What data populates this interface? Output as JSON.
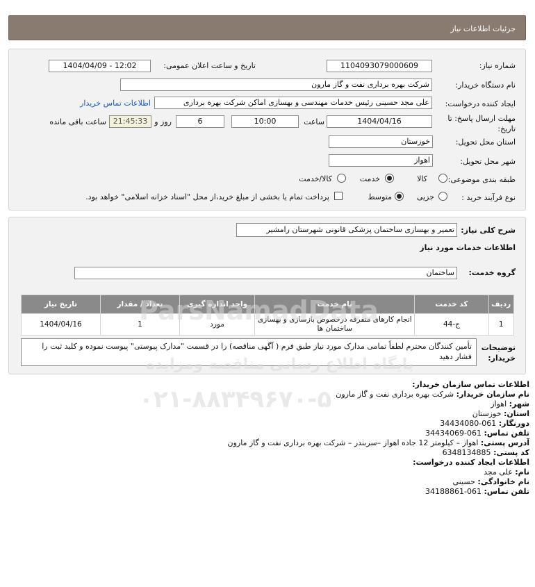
{
  "header": {
    "title": "جزئیات اطلاعات نیاز"
  },
  "fields": {
    "need_number_label": "شماره نیاز:",
    "need_number": "1104093079000609",
    "announce_label": "تاریخ و ساعت اعلان عمومی:",
    "announce_value": "1404/04/09 - 12:02",
    "buyer_org_label": "نام دستگاه خریدار:",
    "buyer_org": "شرکت بهره برداری نفت و گاز مارون",
    "creator_label": "ایجاد کننده درخواست:",
    "creator": "علی مجد حسینی رئیس خدمات مهندسی و بهسازی اماکن شرکت بهره برداری",
    "contact_link": "اطلاعات تماس خریدار",
    "deadline_label_1": "مهلت ارسال پاسخ: تا",
    "deadline_label_2": "تاریخ:",
    "deadline_date": "1404/04/16",
    "time_label": "ساعت",
    "deadline_time": "10:00",
    "days": "6",
    "days_label": "روز و",
    "remaining": "21:45:33",
    "remaining_label": "ساعت باقی مانده",
    "province_label": "استان محل تحویل:",
    "province": "خوزستان",
    "city_label": "شهر محل تحویل:",
    "city": "اهواز",
    "category_label": "طبقه بندی موضوعی:",
    "category_options": [
      "کالا",
      "خدمت",
      "کالا/خدمت"
    ],
    "process_label": "نوع فرآیند خرید :",
    "process_options": [
      "جزیی",
      "متوسط"
    ],
    "payment_note": "پرداخت تمام یا بخشی از مبلغ خرید،از محل \"اسناد خزانه اسلامی\" خواهد بود."
  },
  "summary": {
    "label": "شرح کلی نیاز:",
    "value": "تعمیر و بهسازی ساختمان پزشکی قانونی شهرستان رامشیر",
    "services_title": "اطلاعات خدمات مورد نیاز",
    "group_label": "گروه خدمت:",
    "group_value": "ساختمان"
  },
  "table": {
    "headers": [
      "ردیف",
      "کد خدمت",
      "نام خدمت",
      "واحد اندازه گیری",
      "تعداد / مقدار",
      "تاریخ نیاز"
    ],
    "rows": [
      [
        "1",
        "ج-44",
        "انجام کارهای متفرقه درخصوص بازسازی و بهسازی ساختمان ها",
        "مورد",
        "1",
        "1404/04/16"
      ]
    ]
  },
  "buyer_notes": {
    "label_1": "توضیحات",
    "label_2": "خریدار:",
    "text": "تأمین کنندگان محترم لطفاً تمامی مدارک مورد نیاز طبق فرم ( آگهی مناقصه) را در قسمت \"مدارک پیوستی\" پیوست نموده و کلید ثبت را فشار دهید"
  },
  "contact": {
    "org_title": "اطلاعات تماس سازمان خریدار:",
    "buyer_name_label": "نام سازمان خریدار:",
    "buyer_name": "شرکت بهره برداری نفت و گاز مارون",
    "city_label": "شهر:",
    "city": "اهواز",
    "province_label": "استان:",
    "province": "خوزستان",
    "fax_label": "دورنگار:",
    "fax": "061-34434080",
    "phone_label": "تلفن تماس:",
    "phone": "061-34434069",
    "address_label": "آدرس پستی:",
    "address": "اهواز – کیلومتر 12 جاده اهواز –سربندر – شرکت بهره برداری نفت و گاز مارون",
    "postal_label": "کد پستی:",
    "postal": "6348134885",
    "creator_title": "اطلاعات ایجاد کننده درخواست:",
    "first_name_label": "نام:",
    "first_name": "علی مجد",
    "last_name_label": "نام خانوادگی:",
    "last_name": "حسینی",
    "creator_phone_label": "تلفن تماس:",
    "creator_phone": "061-34188861"
  },
  "watermark": {
    "brand": "ParsNamadData",
    "caption": "پایگاه اطلاع رسانی مناقصه ومزایده",
    "phone": "۰۲۱-۸۸۳۴۹۶۷۰-۵"
  }
}
